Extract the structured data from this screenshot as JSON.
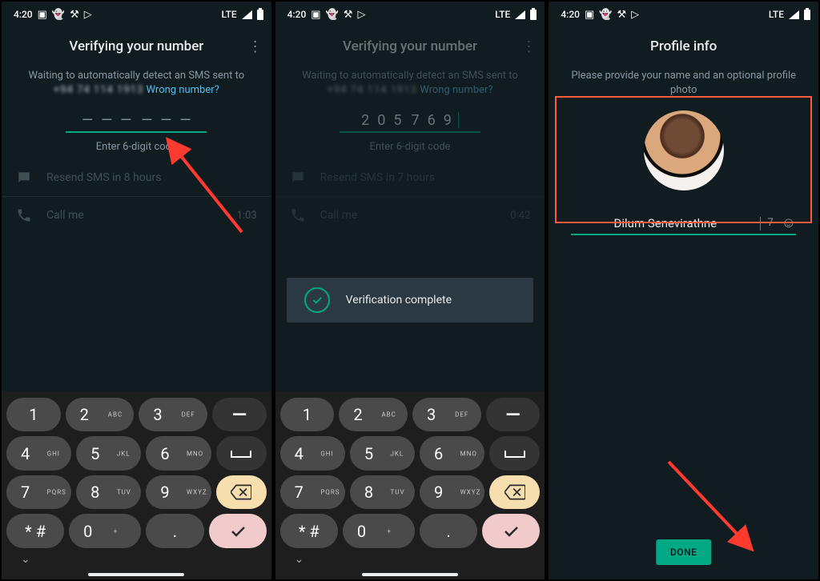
{
  "status": {
    "time": "4:20",
    "network_label": "LTE"
  },
  "screen1": {
    "title": "Verifying your number",
    "wait_text": "Waiting to automatically detect an SMS sent to",
    "phone_masked": "+94 74 114 1913",
    "wrong_link": "Wrong number?",
    "code_digits": [
      "—",
      "—",
      "—",
      "—",
      "—",
      "—"
    ],
    "enter_hint": "Enter 6-digit code",
    "resend_label": "Resend SMS in 8 hours",
    "call_label": "Call me",
    "call_timer": "1:03"
  },
  "screen2": {
    "title": "Verifying your number",
    "wait_text": "Waiting to automatically detect an SMS sent to",
    "phone_masked": "+94 74 114 1913",
    "wrong_link": "Wrong number?",
    "code_digits": [
      "2",
      "0",
      "5",
      "7",
      "6",
      "9"
    ],
    "enter_hint": "Enter 6-digit code",
    "resend_label": "Resend SMS in 7 hours",
    "call_label": "Call me",
    "call_timer": "0:42",
    "banner": "Verification complete"
  },
  "screen3": {
    "title": "Profile info",
    "subtitle": "Please provide your name and an optional profile photo",
    "name_value": "Dilum Senevirathne",
    "name_remaining": "7",
    "done_label": "DONE"
  },
  "keypad": {
    "keys": [
      [
        {
          "d": "1",
          "s": ""
        },
        {
          "d": "2",
          "s": "ABC"
        },
        {
          "d": "3",
          "s": "DEF"
        },
        {
          "d": "—",
          "s": "",
          "cls": "dark dash"
        }
      ],
      [
        {
          "d": "4",
          "s": "GHI"
        },
        {
          "d": "5",
          "s": "JKL"
        },
        {
          "d": "6",
          "s": "MNO"
        },
        {
          "d": "␣",
          "s": "",
          "cls": "dark",
          "svg": "space"
        }
      ],
      [
        {
          "d": "7",
          "s": "PQRS"
        },
        {
          "d": "8",
          "s": "TUV"
        },
        {
          "d": "9",
          "s": "WXYZ"
        },
        {
          "d": "",
          "s": "",
          "cls": "yellow",
          "svg": "back"
        }
      ],
      [
        {
          "d": "* #",
          "s": ""
        },
        {
          "d": "0",
          "s": "+"
        },
        {
          "d": ".",
          "s": ""
        },
        {
          "d": "",
          "s": "",
          "cls": "pink",
          "svg": "check"
        }
      ]
    ]
  }
}
